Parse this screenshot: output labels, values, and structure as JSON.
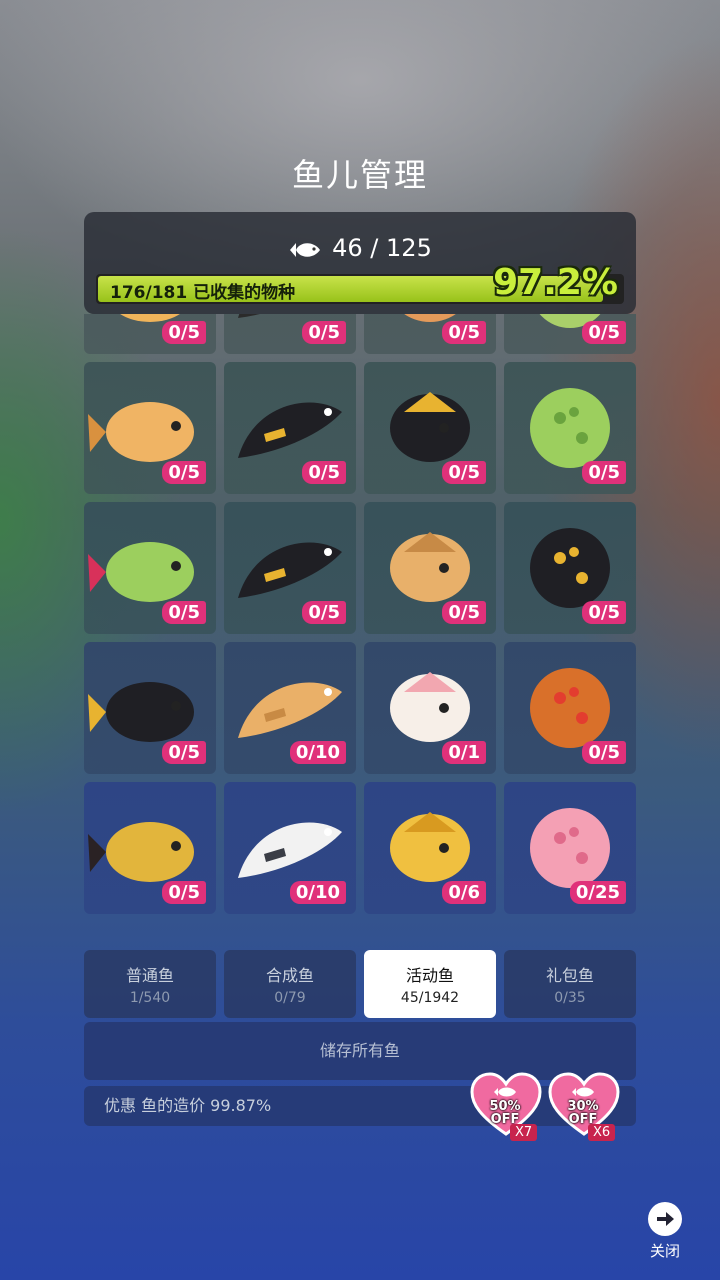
{
  "title": "鱼儿管理",
  "header": {
    "fish_count": "46 / 125",
    "species_label": "176/181 已收集的物种",
    "progress_percent": "97.2%",
    "progress_value": 0.972
  },
  "fish_tiles": [
    {
      "name": "goldfish-orange",
      "count": "0/5",
      "bg": "#4a5a5c",
      "c1": "#f0b45a",
      "c2": "#d88b35"
    },
    {
      "name": "black-gold-eel",
      "count": "0/5",
      "bg": "#4a5a5c",
      "c1": "#2b2b2b",
      "c2": "#c9a23a"
    },
    {
      "name": "lionfish",
      "count": "0/5",
      "bg": "#4a5a5c",
      "c1": "#e49a5a",
      "c2": "#f4d2a8"
    },
    {
      "name": "green-pufferfish",
      "count": "0/5",
      "bg": "#4a5a5c",
      "c1": "#a9cf6a",
      "c2": "#4c7a2a"
    },
    {
      "name": "cuttlefish",
      "count": "0/5",
      "bg": "#3f5658",
      "c1": "#f0b464",
      "c2": "#d9913f"
    },
    {
      "name": "anubis-seahorse",
      "count": "0/5",
      "bg": "#3f5658",
      "c1": "#1f1f24",
      "c2": "#e8b330"
    },
    {
      "name": "anubis-fish",
      "count": "0/5",
      "bg": "#3f5658",
      "c1": "#1f1f24",
      "c2": "#e8b330"
    },
    {
      "name": "cactus-puffer",
      "count": "0/5",
      "bg": "#3f5658",
      "c1": "#9ccf5e",
      "c2": "#6aa33e"
    },
    {
      "name": "flower-puffer",
      "count": "0/5",
      "bg": "#38525a",
      "c1": "#9ccf5e",
      "c2": "#d8315a"
    },
    {
      "name": "pharaoh-eel",
      "count": "0/5",
      "bg": "#38525a",
      "c1": "#1f1f24",
      "c2": "#e8b330"
    },
    {
      "name": "tan-shark",
      "count": "0/5",
      "bg": "#38525a",
      "c1": "#e8b06a",
      "c2": "#c78a46"
    },
    {
      "name": "pharaoh-swordfish",
      "count": "0/5",
      "bg": "#38525a",
      "c1": "#1f1f24",
      "c2": "#e8b330"
    },
    {
      "name": "pharaoh-whale",
      "count": "0/5",
      "bg": "#33496a",
      "c1": "#1f1f24",
      "c2": "#e8b330"
    },
    {
      "name": "humpback-whale",
      "count": "0/10",
      "bg": "#33496a",
      "c1": "#eab068",
      "c2": "#c88a44"
    },
    {
      "name": "fennec-cat",
      "count": "0/1",
      "bg": "#33496a",
      "c1": "#f7efe8",
      "c2": "#f2a7b0"
    },
    {
      "name": "burger-fish",
      "count": "0/5",
      "bg": "#33496a",
      "c1": "#d9702a",
      "c2": "#e33d2f"
    },
    {
      "name": "bumblebee-goby",
      "count": "0/5",
      "bg": "#2e4585",
      "c1": "#e2b53c",
      "c2": "#2a2224"
    },
    {
      "name": "butterfly-fish",
      "count": "0/10",
      "bg": "#2e4585",
      "c1": "#f2f2f2",
      "c2": "#3a3d46"
    },
    {
      "name": "yellow-octopus",
      "count": "0/6",
      "bg": "#2e4585",
      "c1": "#f0c040",
      "c2": "#d89a20"
    },
    {
      "name": "pink-anemone",
      "count": "0/25",
      "bg": "#2e4585",
      "c1": "#f4a0b4",
      "c2": "#e06a8a"
    }
  ],
  "tabs": [
    {
      "label": "普通鱼",
      "count": "1/540"
    },
    {
      "label": "合成鱼",
      "count": "0/79"
    },
    {
      "label": "活动鱼",
      "count": "45/1942"
    },
    {
      "label": "礼包鱼",
      "count": "0/35"
    }
  ],
  "store_all_label": "储存所有鱼",
  "discount_label": "优惠 鱼的造价 99.87%",
  "coupons": [
    {
      "percent": "50%",
      "off": "OFF",
      "mult": "X7"
    },
    {
      "percent": "30%",
      "off": "OFF",
      "mult": "X6"
    }
  ],
  "close_label": "关闭",
  "colors": {
    "progress": "#b5d932",
    "badge": "#e0317a",
    "coupon": "#f06aa0"
  }
}
